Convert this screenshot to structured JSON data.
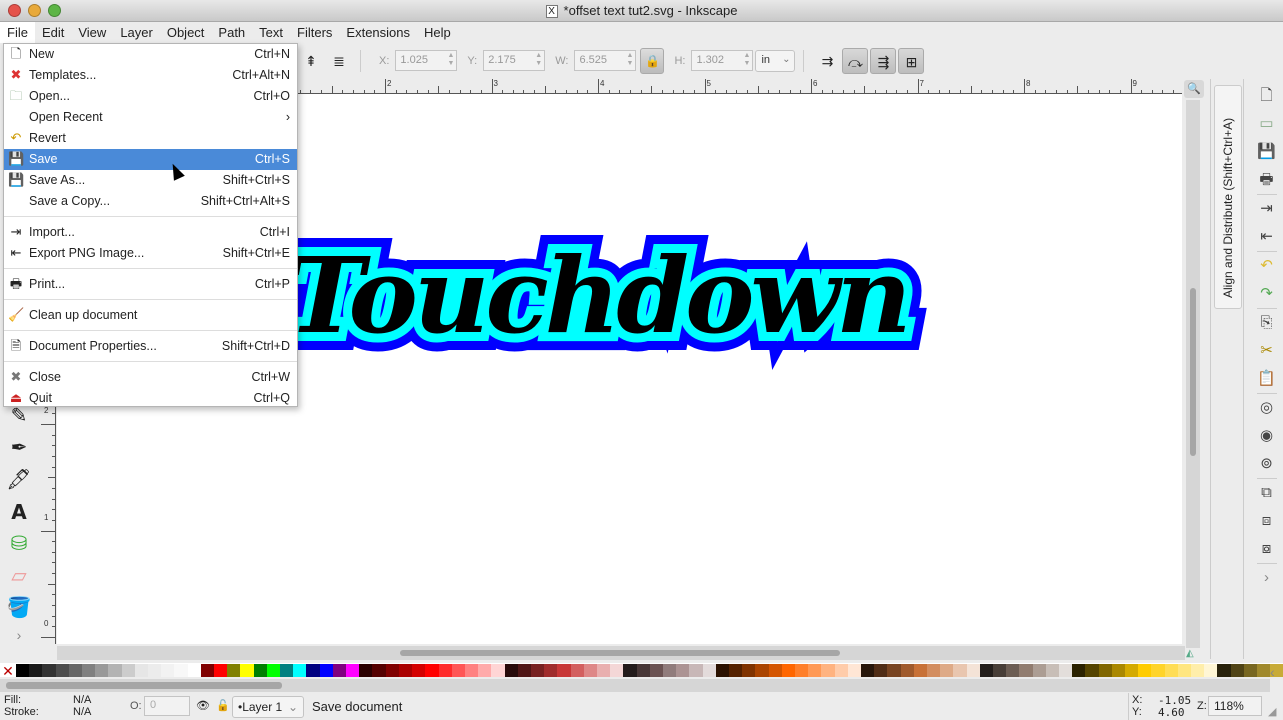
{
  "window": {
    "title": "*offset text tut2.svg - Inkscape",
    "title_icon": "x11-icon"
  },
  "menubar": [
    "File",
    "Edit",
    "View",
    "Layer",
    "Object",
    "Path",
    "Text",
    "Filters",
    "Extensions",
    "Help"
  ],
  "file_menu": {
    "groups": [
      [
        {
          "label": "New",
          "shortcut": "Ctrl+N",
          "icon": "new-document-icon"
        },
        {
          "label": "Templates...",
          "shortcut": "Ctrl+Alt+N",
          "icon": "templates-icon"
        },
        {
          "label": "Open...",
          "shortcut": "Ctrl+O",
          "icon": "folder-open-icon"
        },
        {
          "label": "Open Recent",
          "shortcut": "›",
          "icon": ""
        },
        {
          "label": "Revert",
          "shortcut": "",
          "icon": "revert-icon"
        },
        {
          "label": "Save",
          "shortcut": "Ctrl+S",
          "icon": "save-icon",
          "highlighted": true
        },
        {
          "label": "Save As...",
          "shortcut": "Shift+Ctrl+S",
          "icon": "save-as-icon"
        },
        {
          "label": "Save a Copy...",
          "shortcut": "Shift+Ctrl+Alt+S",
          "icon": ""
        }
      ],
      [
        {
          "label": "Import...",
          "shortcut": "Ctrl+I",
          "icon": "import-icon"
        },
        {
          "label": "Export PNG Image...",
          "shortcut": "Shift+Ctrl+E",
          "icon": "export-icon"
        }
      ],
      [
        {
          "label": "Print...",
          "shortcut": "Ctrl+P",
          "icon": "printer-icon"
        }
      ],
      [
        {
          "label": "Clean up document",
          "shortcut": "",
          "icon": "vacuum-icon"
        }
      ],
      [
        {
          "label": "Document Properties...",
          "shortcut": "Shift+Ctrl+D",
          "icon": "document-properties-icon"
        }
      ],
      [
        {
          "label": "Close",
          "shortcut": "Ctrl+W",
          "icon": "close-icon"
        },
        {
          "label": "Quit",
          "shortcut": "Ctrl+Q",
          "icon": "quit-icon"
        }
      ]
    ]
  },
  "toolbar": {
    "x_label": "X:",
    "x_value": "1.025",
    "y_label": "Y:",
    "y_value": "2.175",
    "w_label": "W:",
    "w_value": "6.525",
    "h_label": "H:",
    "h_value": "1.302",
    "units": "in"
  },
  "ruler_h_labels": [
    "2",
    "3",
    "4",
    "5",
    "6",
    "7",
    "8",
    "9"
  ],
  "ruler_v_labels": [
    "2",
    "1",
    "0"
  ],
  "canvas": {
    "text": "Touchdown",
    "colors": {
      "outer": "#0000ff",
      "middle": "#00ffff",
      "inner": "#000000"
    }
  },
  "dock": {
    "tab_label": "Align and Distribute (Shift+Ctrl+A)"
  },
  "palette": [
    "#000000",
    "#1a1a1a",
    "#333333",
    "#4d4d4d",
    "#666666",
    "#808080",
    "#999999",
    "#b3b3b3",
    "#cccccc",
    "#e6e6e6",
    "#ececec",
    "#f2f2f2",
    "#f8f8f8",
    "#ffffff",
    "#800000",
    "#ff0000",
    "#808000",
    "#ffff00",
    "#008000",
    "#00ff00",
    "#008080",
    "#00ffff",
    "#000080",
    "#0000ff",
    "#800080",
    "#ff00ff",
    "#2b0000",
    "#550000",
    "#800000",
    "#aa0000",
    "#d40000",
    "#ff0000",
    "#ff2a2a",
    "#ff5555",
    "#ff8080",
    "#ffaaaa",
    "#ffd5d5",
    "#280b0b",
    "#501616",
    "#782121",
    "#a02c2c",
    "#c83737",
    "#d35f5f",
    "#de8787",
    "#e9afaf",
    "#f4d7d7",
    "#241c1c",
    "#483737",
    "#6c5353",
    "#917c7c",
    "#ac9393",
    "#c8b7b7",
    "#e3dbdb",
    "#2b1100",
    "#552200",
    "#803300",
    "#aa4400",
    "#d45500",
    "#ff6600",
    "#ff7f2a",
    "#ff9955",
    "#ffb380",
    "#ffccaa",
    "#ffe6d5",
    "#28170b",
    "#502d16",
    "#784421",
    "#a05a2c",
    "#c87137",
    "#d38d5f",
    "#deaa87",
    "#e9c6af",
    "#f4e3d7",
    "#241f1c",
    "#483e37",
    "#6c5d53",
    "#917c6f",
    "#ac9d93",
    "#c8beb7",
    "#e3dedb",
    "#2b2200",
    "#554400",
    "#806600",
    "#aa8800",
    "#d4aa00",
    "#ffcc00",
    "#ffd42a",
    "#ffdd55",
    "#ffe680",
    "#ffeeaa",
    "#fff6d5",
    "#28220b",
    "#504416",
    "#786721",
    "#a0892c",
    "#c8ab37"
  ],
  "status": {
    "fill_label": "Fill:",
    "fill_value": "N/A",
    "stroke_label": "Stroke:",
    "stroke_value": "N/A",
    "opacity_label": "O:",
    "opacity_value": "0",
    "layer": "•Layer 1",
    "message": "Save document",
    "cursor_x_label": "X:",
    "cursor_x": "-1.05",
    "cursor_y_label": "Y:",
    "cursor_y": "4.60",
    "zoom_label": "Z:",
    "zoom": "118%"
  }
}
